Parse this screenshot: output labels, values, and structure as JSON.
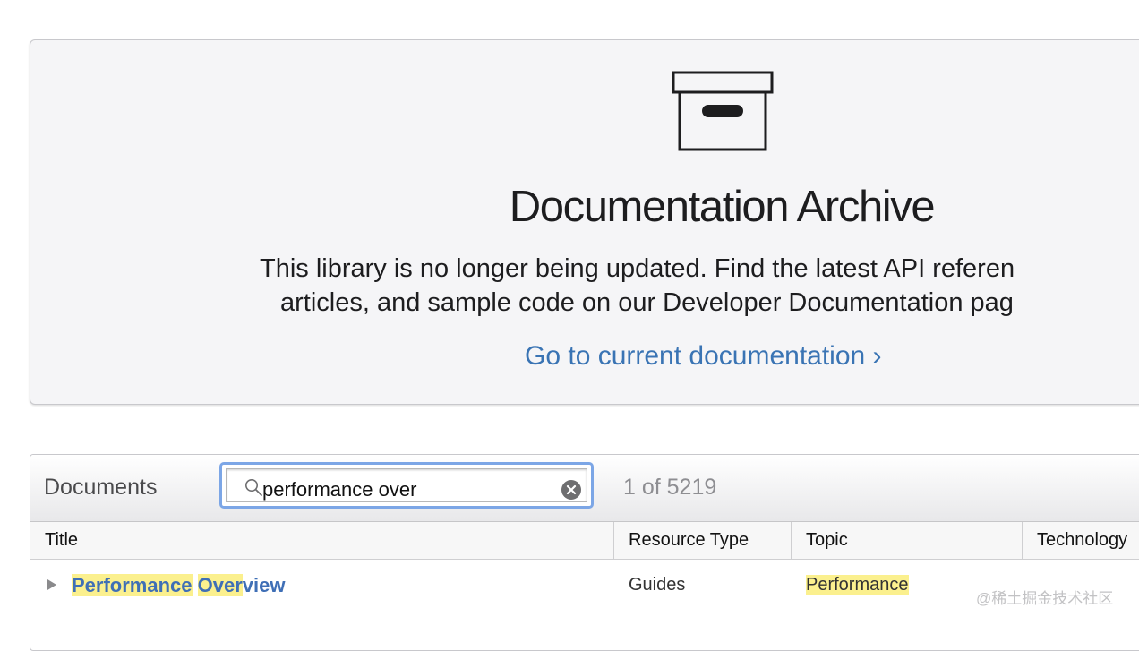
{
  "archive": {
    "icon": "archive-box-icon",
    "title": "Documentation Archive",
    "description_line1": "This library is no longer being updated. Find the latest API referen",
    "description_line2": "articles, and sample code on our Developer Documentation pag",
    "link_label": "Go to current documentation ›"
  },
  "documents": {
    "label": "Documents",
    "search": {
      "value": "performance over",
      "placeholder": "",
      "icons": [
        "search-icon",
        "clear-icon"
      ]
    },
    "result_count": "1 of 5219",
    "columns": [
      "Title",
      "Resource Type",
      "Topic",
      "Technology"
    ],
    "rows": [
      {
        "title_parts": [
          "Performance",
          " ",
          "Over",
          "view"
        ],
        "resource_type": "Guides",
        "topic": "Performance",
        "technology": ""
      }
    ]
  },
  "watermark": "@稀土掘金技术社区",
  "colors": {
    "link_blue": "#3a74b4",
    "title_blue": "#3f6fb6",
    "highlight": "#fbf08e",
    "focus_ring": "#7ca6e6",
    "panel_bg": "#f5f5f7"
  }
}
